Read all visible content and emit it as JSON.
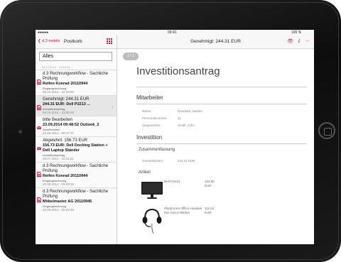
{
  "status_bar": {
    "carrier": "●●●●● ",
    "time": "09:41",
    "battery": "100 %"
  },
  "sidebar": {
    "back_label": "d.3 mobile",
    "title": "Postkorb",
    "filter_value": "Alles",
    "partial_date": "06.12.2014 - 16:28:04",
    "items": [
      {
        "title": "d.3 Rechnungworkflow - Sachliche Prüfung",
        "bold": "Reifen Konrad 20110944",
        "type": "Eingangsrechnung",
        "date": "06.10.2014 - 16:28:50",
        "icon": "document-icon",
        "selected": false
      },
      {
        "title": "Genehmigt: 244.31 EUR",
        "bold": "244.31 EUR: Dell P2213 ...",
        "type": "Investitionsantrag",
        "date": "08.10.2014 - 13:05:46",
        "icon": "document-icon",
        "selected": true
      },
      {
        "title": "bitte Bearbeiten",
        "bold": "23.09.2014 09:48:52 Outlook_2",
        "type": "Schriftverkehr",
        "date": "23.09.2014 - 09:47:37",
        "icon": "mail-icon",
        "selected": false
      },
      {
        "title": "Abgelehnt: 156.73 EUR",
        "bold": "156.73 EUR: Dell Docking Station + Dell Laptop Ständer",
        "type": "Investitionsantrag",
        "date": "25.07.2014 - 10:11:51",
        "icon": "mail-icon",
        "selected": false
      },
      {
        "title": "d.3 Rechnungworkflow - Sachliche Prüfung",
        "bold": "Reifen Konrad 20110944",
        "type": "Eingangsrechnung",
        "date": "20.08.2014 - 09:28:38",
        "icon": "document-icon",
        "selected": false
      },
      {
        "title": "d.3 Rechnungworkflow - Sachliche Prüfung",
        "bold": "Möbelmaster AG 20110945",
        "type": "Eingangsrechnung",
        "date": "20.08.2014 - 09:28:38",
        "icon": "document-icon",
        "selected": false
      }
    ]
  },
  "detail": {
    "nav_title": "Genehmigt: 244.31 EUR",
    "page_indicator": "1 / 1",
    "heading": "Investitionsantrag",
    "employee": {
      "heading": "Mitarbeiter",
      "rows": [
        {
          "label": "Name:",
          "value": "Neustadt, Nadine"
        },
        {
          "label": "Personalnummer:",
          "value": "11"
        },
        {
          "label": "Vorgesetzter:",
          "value": "Smith, John"
        }
      ]
    },
    "investment": {
      "heading": "Investition",
      "summary_heading": "Zusammenfassung",
      "total_label": "Gesamtkosten:",
      "total_value": "244,31 EUR",
      "articles_heading": "Artikel",
      "articles": [
        {
          "name": "Dell P2213",
          "price": "132,80",
          "currency": "EUR",
          "image": "monitor-image"
        },
        {
          "name": "Plantronics Office Headset fürs Cisco-Telefon",
          "price": "111,51",
          "currency": "EUR",
          "image": "headset-image"
        }
      ]
    }
  },
  "colors": {
    "accent": "#d0164f"
  }
}
